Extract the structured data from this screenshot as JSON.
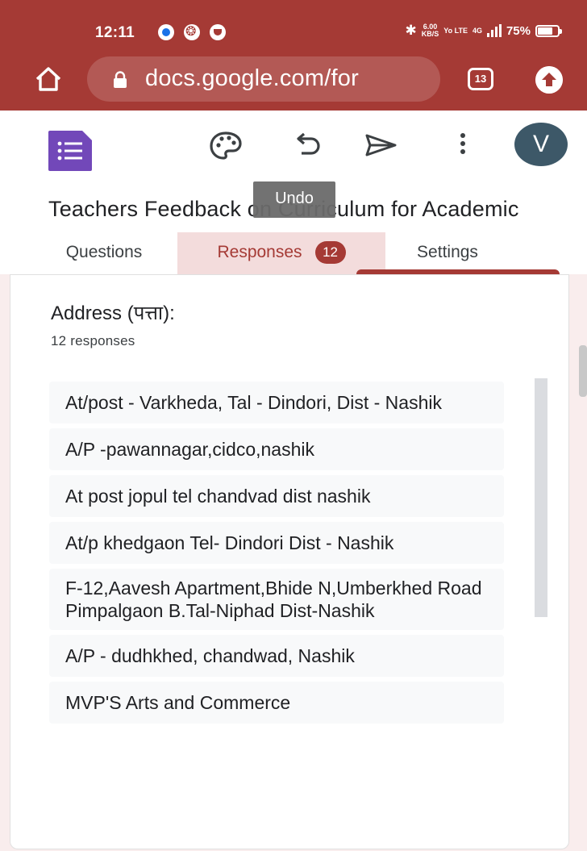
{
  "status_bar": {
    "time": "12:11",
    "speed": "6.00",
    "speed_unit": "KB/S",
    "network": "Yo LTE",
    "signal": "4G",
    "battery": "75%"
  },
  "browser": {
    "url": "docs.google.com/for",
    "tab_count": "13"
  },
  "toolbar": {
    "avatar_letter": "V",
    "undo_tooltip": "Undo"
  },
  "form": {
    "title": "Teachers Feedback on Curriculum for Academic",
    "tabs": [
      {
        "label": "Questions"
      },
      {
        "label": "Responses",
        "badge": "12"
      },
      {
        "label": "Settings"
      }
    ]
  },
  "question": {
    "title": "Address (पत्ता):",
    "count": "12 responses",
    "answers": [
      "At/post - Varkheda, Tal - Dindori, Dist - Nashik",
      "A/P -pawannagar,cidco,nashik",
      "At post jopul tel chandvad dist nashik",
      "At/p khedgaon Tel- Dindori Dist - Nashik",
      "F-12,Aavesh Apartment,Bhide N,Umberkhed Road Pimpalgaon B.Tal-Niphad Dist-Nashik",
      "A/P - dudhkhed, chandwad, Nashik",
      "MVP'S Arts and Commerce"
    ]
  },
  "colors": {
    "theme": "#a53a35",
    "tab_highlight": "#f3dcdc",
    "forms_purple": "#7248b9",
    "avatar_bg": "#3d5868"
  }
}
